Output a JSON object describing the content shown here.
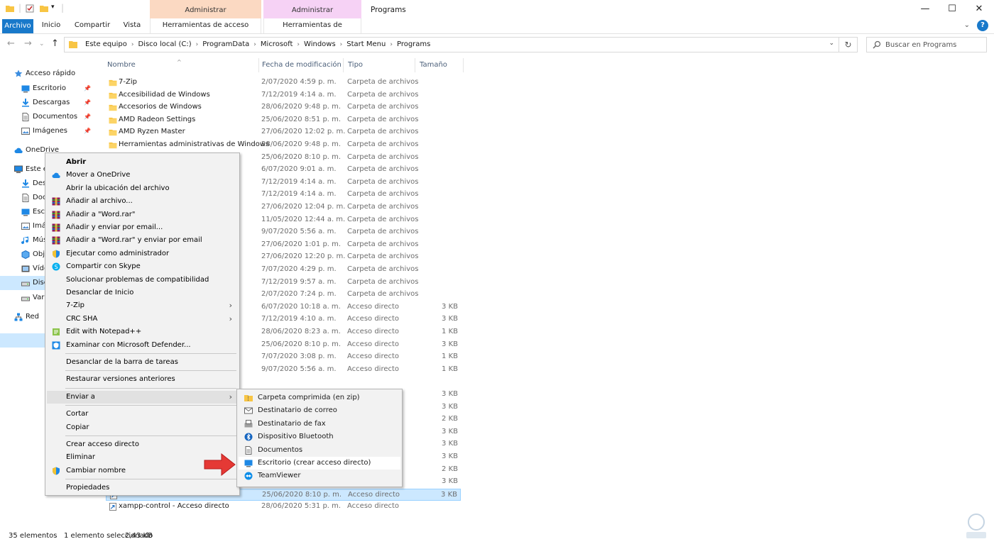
{
  "window": {
    "title": "Programs",
    "context_groups": [
      "Administrar",
      "Administrar"
    ],
    "controls": {
      "minimize": "—",
      "maximize": "☐",
      "close": "✕"
    }
  },
  "ribbon": {
    "tabs": [
      "Archivo",
      "Inicio",
      "Compartir",
      "Vista",
      "Herramientas de acceso directo",
      "Herramientas de aplicación"
    ],
    "collapse_glyph": "⌄",
    "help_glyph": "?"
  },
  "address": {
    "back": "←",
    "forward": "→",
    "recent": "⌄",
    "up": "↑",
    "crumbs": [
      "Este equipo",
      "Disco local (C:)",
      "ProgramData",
      "Microsoft",
      "Windows",
      "Start Menu",
      "Programs"
    ],
    "separator": "›",
    "dropdown": "⌄",
    "refresh": "↻",
    "search_placeholder": "Buscar en Programs"
  },
  "nav": {
    "items": [
      {
        "label": "Acceso rápido",
        "icon": "star-icon",
        "pinned": false
      },
      {
        "label": "Escritorio",
        "icon": "desktop-icon",
        "pinned": true
      },
      {
        "label": "Descargas",
        "icon": "download-icon",
        "pinned": true
      },
      {
        "label": "Documentos",
        "icon": "document-icon",
        "pinned": true
      },
      {
        "label": "Imágenes",
        "icon": "pictures-icon",
        "pinned": true
      },
      {
        "label": "OneDrive",
        "icon": "cloud-icon",
        "pinned": false
      },
      {
        "label": "Este e",
        "icon": "computer-icon",
        "pinned": false
      },
      {
        "label": "Desc",
        "icon": "download-icon",
        "pinned": false
      },
      {
        "label": "Doc",
        "icon": "document-icon",
        "pinned": false
      },
      {
        "label": "Escr",
        "icon": "desktop-icon",
        "pinned": false
      },
      {
        "label": "Imá",
        "icon": "pictures-icon",
        "pinned": false
      },
      {
        "label": "Mús",
        "icon": "music-icon",
        "pinned": false
      },
      {
        "label": "Obj",
        "icon": "cube-icon",
        "pinned": false
      },
      {
        "label": "Víde",
        "icon": "video-icon",
        "pinned": false
      },
      {
        "label": "Disc",
        "icon": "drive-icon",
        "pinned": false
      },
      {
        "label": "Vari",
        "icon": "drive-icon",
        "pinned": false
      },
      {
        "label": "Red",
        "icon": "network-icon",
        "pinned": false
      }
    ],
    "pin_glyph": "📌"
  },
  "columns": [
    "Nombre",
    "Fecha de modificación",
    "Tipo",
    "Tamaño"
  ],
  "sort_glyph": "^",
  "files": [
    {
      "name": "7-Zip",
      "date": "2/07/2020 4:59 p. m.",
      "type": "Carpeta de archivos",
      "size": "",
      "icon": "folder-icon"
    },
    {
      "name": "Accesibilidad de Windows",
      "date": "7/12/2019 4:14 a. m.",
      "type": "Carpeta de archivos",
      "size": "",
      "icon": "folder-icon"
    },
    {
      "name": "Accesorios de Windows",
      "date": "28/06/2020 9:48 p. m.",
      "type": "Carpeta de archivos",
      "size": "",
      "icon": "folder-icon"
    },
    {
      "name": "AMD Radeon Settings",
      "date": "25/06/2020 8:51 p. m.",
      "type": "Carpeta de archivos",
      "size": "",
      "icon": "folder-icon"
    },
    {
      "name": "AMD Ryzen Master",
      "date": "27/06/2020 12:02 p. m.",
      "type": "Carpeta de archivos",
      "size": "",
      "icon": "folder-icon"
    },
    {
      "name": "Herramientas administrativas de Windows",
      "date": "28/06/2020 9:48 p. m.",
      "type": "Carpeta de archivos",
      "size": "",
      "icon": "folder-icon"
    },
    {
      "name": "",
      "date": "25/06/2020 8:10 p. m.",
      "type": "Carpeta de archivos",
      "size": "",
      "icon": ""
    },
    {
      "name": "",
      "date": "6/07/2020 9:01 a. m.",
      "type": "Carpeta de archivos",
      "size": "",
      "icon": ""
    },
    {
      "name": "",
      "date": "7/12/2019 4:14 a. m.",
      "type": "Carpeta de archivos",
      "size": "",
      "icon": ""
    },
    {
      "name": "",
      "date": "7/12/2019 4:14 a. m.",
      "type": "Carpeta de archivos",
      "size": "",
      "icon": ""
    },
    {
      "name": "",
      "date": "27/06/2020 12:04 p. m.",
      "type": "Carpeta de archivos",
      "size": "",
      "icon": ""
    },
    {
      "name": "",
      "date": "11/05/2020 12:44 a. m.",
      "type": "Carpeta de archivos",
      "size": "",
      "icon": ""
    },
    {
      "name": "",
      "date": "9/07/2020 5:56 a. m.",
      "type": "Carpeta de archivos",
      "size": "",
      "icon": ""
    },
    {
      "name": "",
      "date": "27/06/2020 1:01 p. m.",
      "type": "Carpeta de archivos",
      "size": "",
      "icon": ""
    },
    {
      "name": "",
      "date": "27/06/2020 12:20 p. m.",
      "type": "Carpeta de archivos",
      "size": "",
      "icon": ""
    },
    {
      "name": "",
      "date": "7/07/2020 4:29 p. m.",
      "type": "Carpeta de archivos",
      "size": "",
      "icon": ""
    },
    {
      "name": "",
      "date": "7/12/2019 9:57 a. m.",
      "type": "Carpeta de archivos",
      "size": "",
      "icon": ""
    },
    {
      "name": "",
      "date": "2/07/2020 7:24 p. m.",
      "type": "Carpeta de archivos",
      "size": "",
      "icon": ""
    },
    {
      "name": "",
      "date": "6/07/2020 10:18 a. m.",
      "type": "Acceso directo",
      "size": "3 KB",
      "icon": ""
    },
    {
      "name": "",
      "date": "7/12/2019 4:10 a. m.",
      "type": "Acceso directo",
      "size": "3 KB",
      "icon": ""
    },
    {
      "name": "",
      "date": "28/06/2020 8:23 a. m.",
      "type": "Acceso directo",
      "size": "1 KB",
      "icon": ""
    },
    {
      "name": "",
      "date": "25/06/2020 8:10 p. m.",
      "type": "Acceso directo",
      "size": "3 KB",
      "icon": ""
    },
    {
      "name": "",
      "date": "7/07/2020 3:08 p. m.",
      "type": "Acceso directo",
      "size": "1 KB",
      "icon": ""
    },
    {
      "name": "",
      "date": "9/07/2020 5:56 a. m.",
      "type": "Acceso directo",
      "size": "1 KB",
      "icon": ""
    },
    {
      "name": "",
      "date": "",
      "type": "",
      "size": "",
      "icon": ""
    },
    {
      "name": "",
      "date": "",
      "type": "",
      "size": "3 KB",
      "icon": ""
    },
    {
      "name": "",
      "date": "",
      "type": "",
      "size": "3 KB",
      "icon": ""
    },
    {
      "name": "",
      "date": "",
      "type": "",
      "size": "2 KB",
      "icon": ""
    },
    {
      "name": "",
      "date": "",
      "type": "",
      "size": "3 KB",
      "icon": ""
    },
    {
      "name": "",
      "date": "",
      "type": "",
      "size": "3 KB",
      "icon": ""
    },
    {
      "name": "",
      "date": "",
      "type": "",
      "size": "3 KB",
      "icon": ""
    },
    {
      "name": "",
      "date": "",
      "type": "",
      "size": "2 KB",
      "icon": ""
    },
    {
      "name": "",
      "date": "",
      "type": "",
      "size": "3 KB",
      "icon": ""
    },
    {
      "name": "",
      "date": "25/06/2020 8:10 p. m.",
      "type": "Acceso directo",
      "size": "3 KB",
      "icon": "shortcut-icon",
      "selected": true
    },
    {
      "name": "xampp-control - Acceso directo",
      "date": "28/06/2020 5:31 p. m.",
      "type": "Acceso directo",
      "size": "",
      "icon": "shortcut-icon"
    }
  ],
  "context_menu": {
    "groups": [
      [
        {
          "label": "Abrir",
          "icon": "",
          "bold": true
        },
        {
          "label": "Mover a OneDrive",
          "icon": "cloud-icon"
        },
        {
          "label": "Abrir la ubicación del archivo",
          "icon": ""
        },
        {
          "label": "Añadir al archivo...",
          "icon": "winrar-icon"
        },
        {
          "label": "Añadir a \"Word.rar\"",
          "icon": "winrar-icon"
        },
        {
          "label": "Añadir y enviar por email...",
          "icon": "winrar-icon"
        },
        {
          "label": "Añadir a \"Word.rar\" y enviar por email",
          "icon": "winrar-icon"
        },
        {
          "label": "Ejecutar como administrador",
          "icon": "shield-icon"
        },
        {
          "label": "Compartir con Skype",
          "icon": "skype-icon"
        },
        {
          "label": "Solucionar problemas de compatibilidad",
          "icon": ""
        },
        {
          "label": "Desanclar de Inicio",
          "icon": ""
        },
        {
          "label": "7-Zip",
          "icon": "",
          "submenu": true
        },
        {
          "label": "CRC SHA",
          "icon": "",
          "submenu": true
        },
        {
          "label": "Edit with Notepad++",
          "icon": "notepad-icon"
        },
        {
          "label": "Examinar con Microsoft Defender...",
          "icon": "defender-icon"
        }
      ],
      [
        {
          "label": "Desanclar de la barra de tareas",
          "icon": ""
        }
      ],
      [
        {
          "label": "Restaurar versiones anteriores",
          "icon": ""
        }
      ],
      [
        {
          "label": "Enviar a",
          "icon": "",
          "submenu": true,
          "hover": true
        }
      ],
      [
        {
          "label": "Cortar",
          "icon": ""
        },
        {
          "label": "Copiar",
          "icon": ""
        }
      ],
      [
        {
          "label": "Crear acceso directo",
          "icon": ""
        },
        {
          "label": "Eliminar",
          "icon": ""
        },
        {
          "label": "Cambiar nombre",
          "icon": "shield-icon"
        }
      ],
      [
        {
          "label": "Propiedades",
          "icon": ""
        }
      ]
    ],
    "submenu_arrow": "›"
  },
  "send_to_menu": [
    {
      "label": "Carpeta comprimida (en zip)",
      "icon": "zip-folder-icon"
    },
    {
      "label": "Destinatario de correo",
      "icon": "mail-icon"
    },
    {
      "label": "Destinatario de fax",
      "icon": "fax-icon"
    },
    {
      "label": "Dispositivo Bluetooth",
      "icon": "bluetooth-icon"
    },
    {
      "label": "Documentos",
      "icon": "document-icon"
    },
    {
      "label": "Escritorio (crear acceso directo)",
      "icon": "desktop-icon",
      "hover": true
    },
    {
      "label": "TeamViewer",
      "icon": "teamviewer-icon"
    }
  ],
  "status": {
    "count": "35 elementos",
    "selected": "1 elemento seleccionado",
    "size": "2,43 KB"
  },
  "colors": {
    "accent": "#1979ca",
    "selection": "#cce8ff",
    "folder": "#f8c544",
    "arrow": "#e53935"
  }
}
